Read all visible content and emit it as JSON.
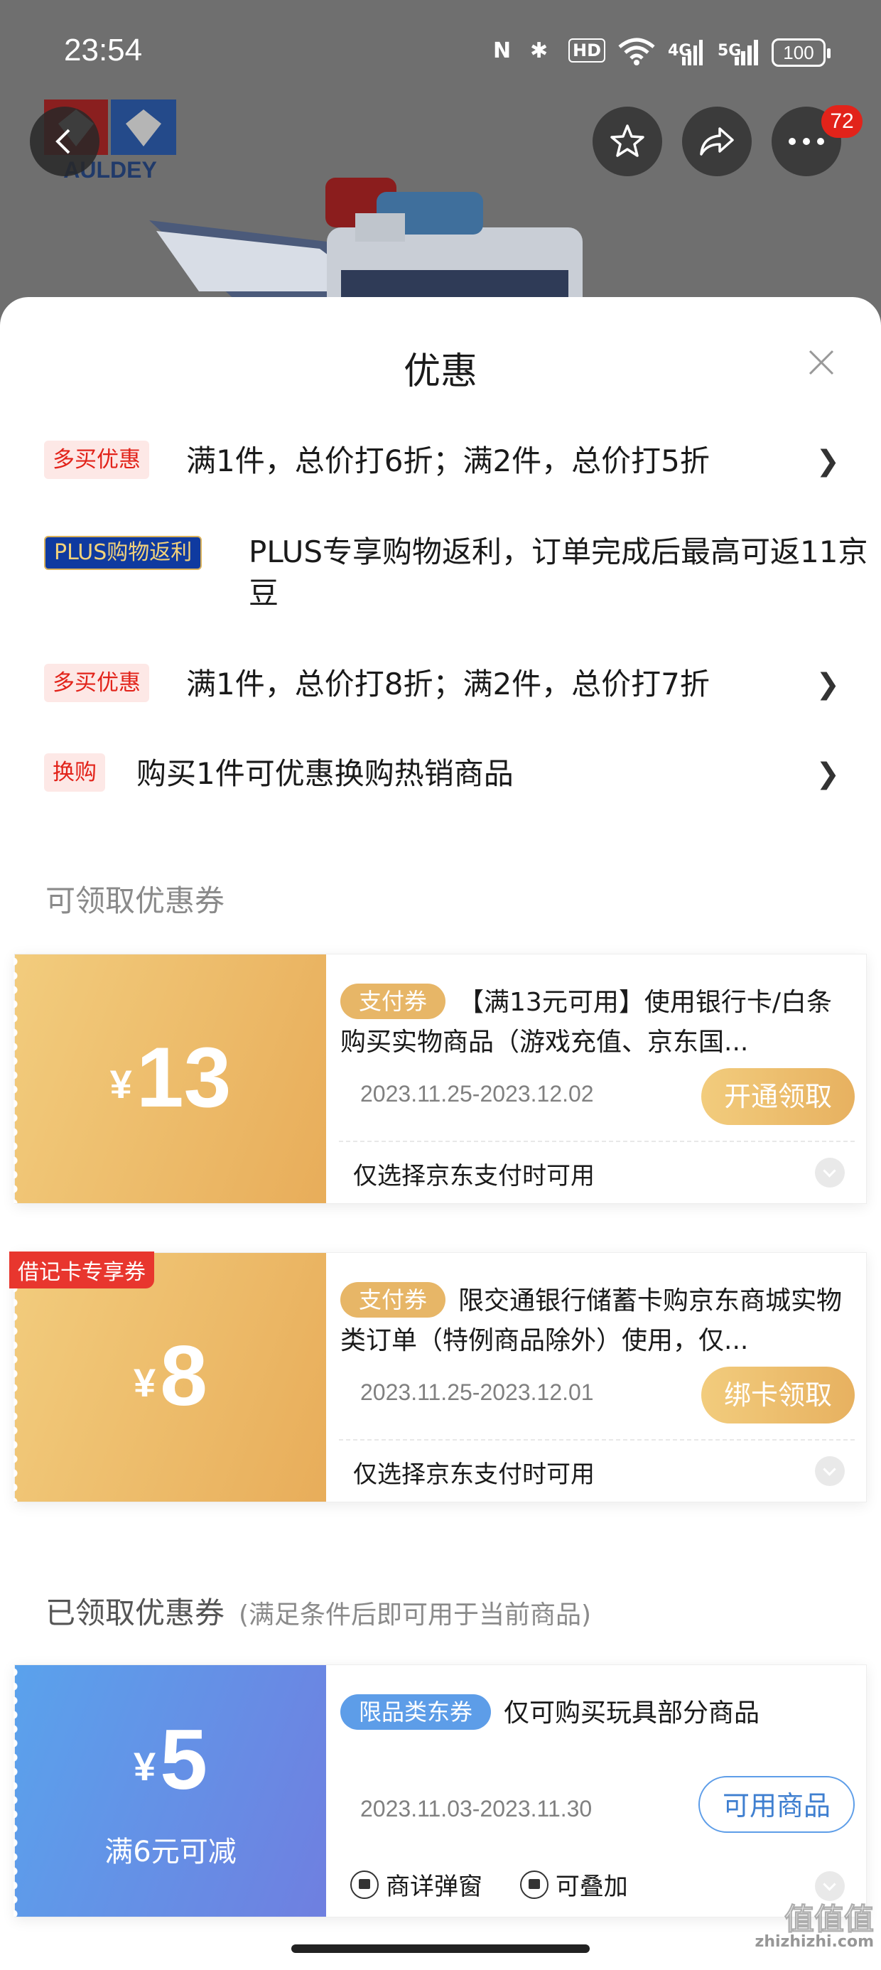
{
  "status_bar": {
    "time": "23:54",
    "battery": "100",
    "network_labels": [
      "4G",
      "5G"
    ]
  },
  "header": {
    "badge_count": "72",
    "brand": "AULDEY"
  },
  "sheet": {
    "title": "优惠",
    "promotions": [
      {
        "tag": "多买优惠",
        "text": "满1件，总价打6折；满2件，总价打5折",
        "arrow": "❯",
        "tag_style": "red"
      },
      {
        "tag": "PLUS购物返利",
        "text": "PLUS专享购物返利，订单完成后最高可返11京豆",
        "arrow": "",
        "tag_style": "plus"
      },
      {
        "tag": "多买优惠",
        "text": "满1件，总价打8折；满2件，总价打7折",
        "arrow": "❯",
        "tag_style": "red"
      },
      {
        "tag": "换购",
        "text": "购买1件可优惠换购热销商品",
        "arrow": "❯",
        "tag_style": "red"
      }
    ],
    "available_section": {
      "title": "可领取优惠券"
    },
    "available_coupons": [
      {
        "currency": "¥",
        "amount": "13",
        "type": "支付券",
        "title": "【满13元可用】使用银行卡/白条购买实物商品（游戏充值、京东国...",
        "date": "2023.11.25-2023.12.02",
        "action": "开通领取",
        "footer": "仅选择京东支付时可用"
      },
      {
        "badge": "借记卡专享券",
        "currency": "¥",
        "amount": "8",
        "type": "支付券",
        "title": "限交通银行储蓄卡购京东商城实物类订单（特例商品除外）使用，仅...",
        "date": "2023.11.25-2023.12.01",
        "action": "绑卡领取",
        "footer": "仅选择京东支付时可用"
      }
    ],
    "claimed_section": {
      "title": "已领取优惠券",
      "subtitle": "(满足条件后即可用于当前商品)"
    },
    "claimed_coupons": [
      {
        "currency": "¥",
        "amount": "5",
        "condition": "满6元可减",
        "type": "限品类东券",
        "title": "仅可购买玩具部分商品",
        "date": "2023.11.03-2023.11.30",
        "action": "可用商品",
        "features": [
          "商详弹窗",
          "可叠加"
        ]
      }
    ]
  },
  "watermark": {
    "main": "值值值",
    "site": "zhizhizhi.com"
  },
  "colors": {
    "accent_red": "#e2231a",
    "coupon_gold": "#e8ad5a",
    "coupon_blue": "#5d9de8",
    "plus_navy": "#0f3aa0"
  }
}
